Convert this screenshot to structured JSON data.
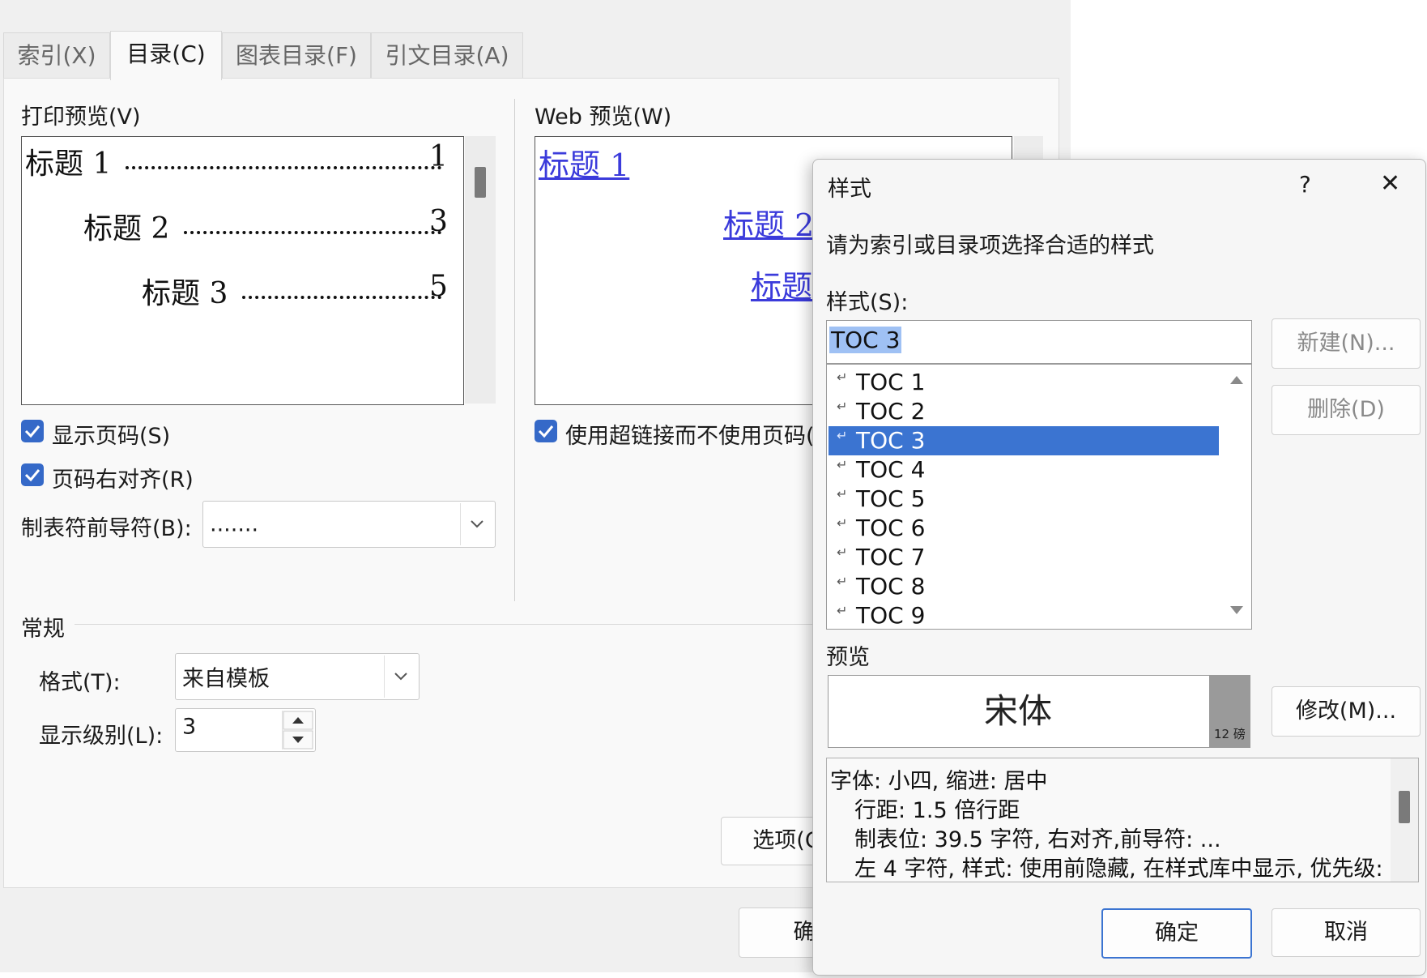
{
  "tabs": [
    {
      "label": "索引(X)"
    },
    {
      "label": "目录(C)"
    },
    {
      "label": "图表目录(F)"
    },
    {
      "label": "引文目录(A)"
    }
  ],
  "print_preview": {
    "label": "打印预览(V)",
    "entries": [
      {
        "text": "标题  1",
        "page": "1"
      },
      {
        "text": "标题  2",
        "page": "3"
      },
      {
        "text": "标题  3",
        "page": "5"
      }
    ]
  },
  "web_preview": {
    "label": "Web 预览(W)",
    "links": [
      "标题  1",
      "标题  2",
      "标题"
    ]
  },
  "options": {
    "show_page_numbers": "显示页码(S)",
    "right_align": "页码右对齐(R)",
    "use_hyperlinks": "使用超链接而不使用页码(",
    "tab_leader_label": "制表符前导符(B):",
    "tab_leader_value": "......."
  },
  "general": {
    "section_label": "常规",
    "format_label": "格式(T):",
    "format_value": "来自模板",
    "levels_label": "显示级别(L):",
    "levels_value": "3"
  },
  "main_buttons": {
    "options": "选项(C",
    "ok": "确"
  },
  "style_dialog": {
    "title": "样式",
    "help": "?",
    "close": "✕",
    "instruction": "请为索引或目录项选择合适的样式",
    "style_label": "样式(S):",
    "style_input": "TOC 3",
    "new_button": "新建(N)...",
    "delete_button": "删除(D)",
    "styles": [
      "TOC 1",
      "TOC 2",
      "TOC 3",
      "TOC 4",
      "TOC 5",
      "TOC 6",
      "TOC 7",
      "TOC 8",
      "TOC 9"
    ],
    "selected_style": "TOC 3",
    "preview_label": "预览",
    "preview_font": "宋体",
    "preview_size": "12 磅",
    "modify_button": "修改(M)...",
    "description": [
      "字体: 小四, 缩进: 居中",
      "行距: 1.5 倍行距",
      "制表位:  39.5 字符, 右对齐,前导符: ...",
      "左  4 字符, 样式: 使用前隐藏, 在样式库中显示, 优先级:"
    ],
    "ok": "确定",
    "cancel": "取消"
  },
  "colors": {
    "accent": "#3b74d1",
    "checkbox": "#3569c8",
    "link": "#3b3bdb"
  }
}
